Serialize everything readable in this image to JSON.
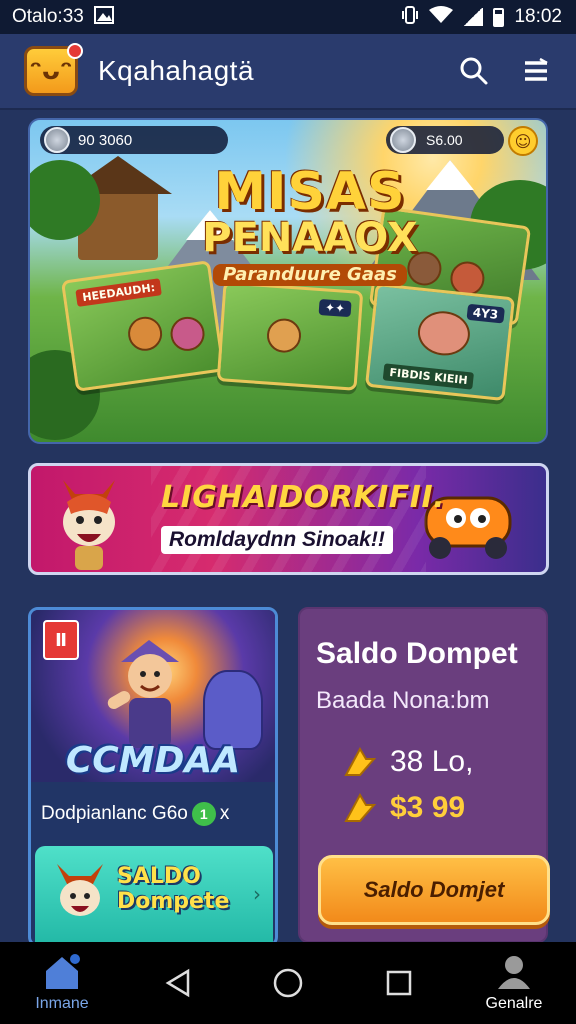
{
  "status_bar": {
    "left_text": "Otalo:33",
    "time": "18:02",
    "icons": [
      "gallery-icon",
      "vibrate-icon",
      "wifi-icon",
      "signal-icon",
      "battery-icon"
    ]
  },
  "header": {
    "logo": "game-face-logo",
    "title": "Kqahahagtä",
    "icons": [
      "search-icon",
      "menu-icon"
    ]
  },
  "hero": {
    "coin_value": "90 3060",
    "right_value": "S6.00",
    "title_line1": "MISAS",
    "title_line2": "PENAAOX",
    "title_line3": "Paranduure Gaas",
    "card1_label": "HEEDAUDH:",
    "card3_label": "FIBDIS KIEIH",
    "card3_badge": "4Y3"
  },
  "promo": {
    "title": "LIGHAIDORKIFII.",
    "subtitle": "Romldaydnn Sinoak!!"
  },
  "game_tile": {
    "tag": "Ⅱ",
    "title": "CCMDAA",
    "caption": "Dodpianlanc G6o",
    "chip": "1",
    "close": "x",
    "cta_line1": "SALDO",
    "cta_line2": "Dompete"
  },
  "wallet": {
    "title": "Saldo Dompet",
    "subtitle": "Baada Nona:bm",
    "row1": "38 Lo,",
    "row2": "$3 99",
    "button": "Saldo Domjet",
    "colors": {
      "card": "#6a3e7e",
      "button": "#f5a02a",
      "highlight": "#ffcf3a"
    }
  },
  "nav": {
    "home_label": "Inmane",
    "profile_label": "Genalre",
    "icons": [
      "home-icon",
      "back-icon",
      "home-circle-icon",
      "recents-icon",
      "profile-icon"
    ]
  }
}
